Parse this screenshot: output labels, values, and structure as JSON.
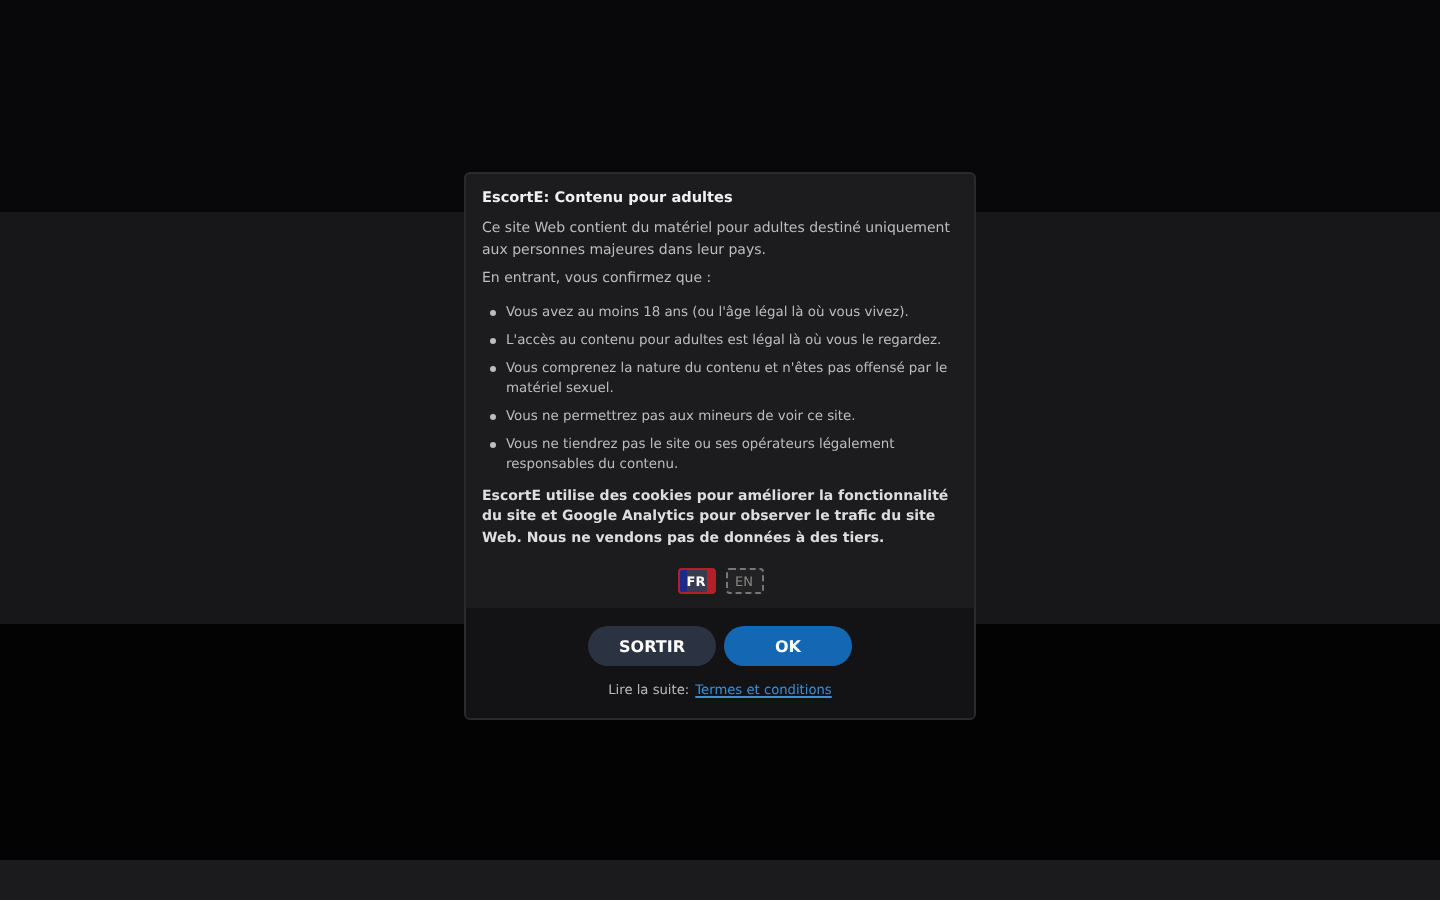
{
  "modal": {
    "title": "EscortE: Contenu pour adultes",
    "intro": "Ce site Web contient du matériel pour adultes destiné uniquement aux personnes majeures dans leur pays.",
    "lead": "En entrant, vous confirmez que :",
    "bullets": [
      "Vous avez au moins 18 ans (ou l'âge légal là où vous vivez).",
      "L'accès au contenu pour adultes est légal là où vous le regardez.",
      "Vous comprenez la nature du contenu et n'êtes pas offensé par le matériel sexuel.",
      "Vous ne permettrez pas aux mineurs de voir ce site.",
      "Vous ne tiendrez pas le site ou ses opérateurs légalement responsables du contenu."
    ],
    "cookies": "EscortE utilise des cookies pour améliorer la fonctionnalité du site et Google Analytics pour observer le trafic du site Web. Nous ne vendons pas de données à des tiers.",
    "languages": [
      {
        "label": "FR",
        "selected": true
      },
      {
        "label": "EN",
        "selected": false
      }
    ],
    "buttons": [
      {
        "label": "SORTIR",
        "kind": "secondary"
      },
      {
        "label": "OK",
        "kind": "primary"
      }
    ],
    "read_more": {
      "prefix": "Lire la suite:",
      "link": "Termes et conditions"
    }
  }
}
